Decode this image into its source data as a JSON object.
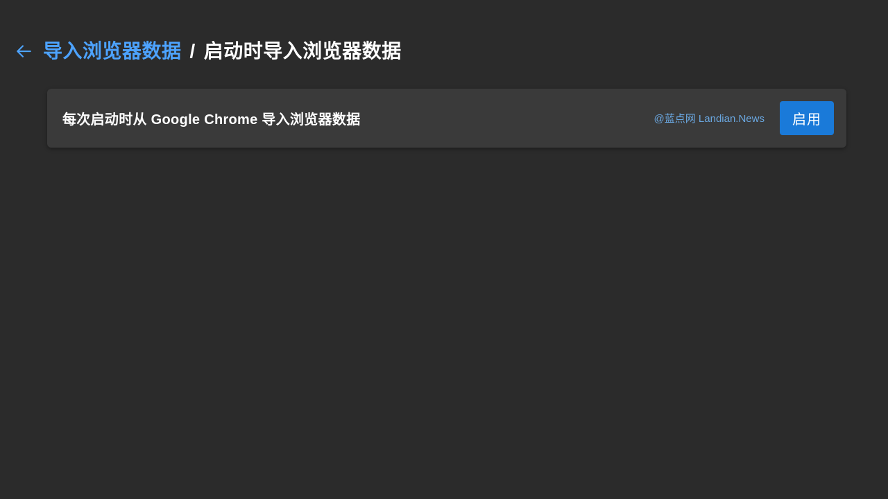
{
  "breadcrumb": {
    "parent": "导入浏览器数据",
    "separator": "/",
    "current": "启动时导入浏览器数据"
  },
  "card": {
    "title": "每次启动时从 Google Chrome 导入浏览器数据",
    "watermark": "@蓝点网 Landian.News",
    "button_label": "启用"
  }
}
